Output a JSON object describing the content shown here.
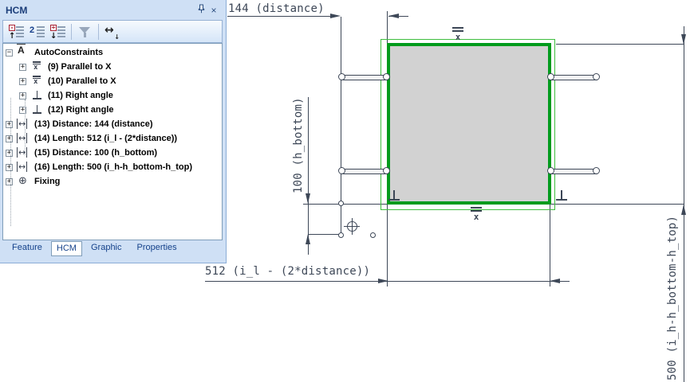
{
  "panel": {
    "title": "HCM",
    "window_buttons": {
      "pin": "pin",
      "close": "×"
    },
    "toolbar": {
      "icons": [
        {
          "name": "collapse-all-icon",
          "badge": "-",
          "arrow": "↑"
        },
        {
          "name": "expand-level-2-icon",
          "label": "2"
        },
        {
          "name": "expand-all-icon",
          "badge": "+",
          "arrow": "↓"
        },
        {
          "name": "filter-icon"
        },
        {
          "name": "fit-width-icon",
          "arrow": "↔",
          "sub_arrow": "↓"
        }
      ]
    },
    "tree": [
      {
        "label": "AutoConstraints",
        "icon": "autoconstraint",
        "level": 0,
        "expander": "minus"
      },
      {
        "label": "(9) Parallel to X",
        "icon": "parallel-x",
        "level": 1,
        "expander": "plus"
      },
      {
        "label": "(10) Parallel to X",
        "icon": "parallel-x",
        "level": 1,
        "expander": "plus"
      },
      {
        "label": "(11) Right angle",
        "icon": "right-angle",
        "level": 1,
        "expander": "plus"
      },
      {
        "label": "(12) Right angle",
        "icon": "right-angle",
        "level": 1,
        "expander": "plus"
      },
      {
        "label": "(13) Distance: 144 (distance)",
        "icon": "distance",
        "level": 0,
        "expander": "plus"
      },
      {
        "label": "(14) Length: 512 (i_l - (2*distance))",
        "icon": "distance",
        "level": 0,
        "expander": "plus"
      },
      {
        "label": "(15) Distance: 100 (h_bottom)",
        "icon": "distance",
        "level": 0,
        "expander": "plus"
      },
      {
        "label": "(16) Length: 500 (i_h-h_bottom-h_top)",
        "icon": "distance",
        "level": 0,
        "expander": "plus"
      },
      {
        "label": "Fixing",
        "icon": "fixing",
        "level": 0,
        "expander": "plus"
      }
    ],
    "tabs": [
      {
        "label": "Feature",
        "active": false
      },
      {
        "label": "HCM",
        "active": true
      },
      {
        "label": "Graphic",
        "active": false
      },
      {
        "label": "Properties",
        "active": false
      }
    ]
  },
  "canvas": {
    "dim_top": "144 (distance)",
    "dim_bottom": "512 (i_l - (2*distance))",
    "dim_left": "100 (h_bottom)",
    "dim_right": "500 (i_h-h_bottom-h_top)",
    "parallel_glyph": "x",
    "colors": {
      "sketch_line": "#3d4757",
      "square_border": "#009b1c",
      "square_fill": "#d2d2d2",
      "outer_frame": "#3fbe3f",
      "panel_bg": "#cfe0f5",
      "tab_text": "#15428b"
    }
  }
}
